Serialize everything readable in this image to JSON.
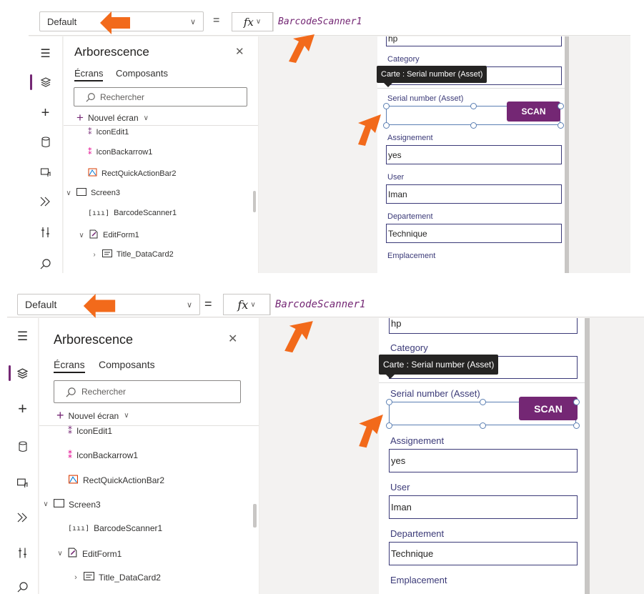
{
  "formula_bar": {
    "property": "Default",
    "equals": "=",
    "fx": "fx",
    "fx_chevron": "∨",
    "select_chevron": "∨",
    "formula": "BarcodeScanner1"
  },
  "tree_view": {
    "title": "Arborescence",
    "close": "✕",
    "tabs": [
      "Écrans",
      "Composants"
    ],
    "search_placeholder": "Rechercher",
    "new_screen": "Nouvel écran",
    "items": [
      {
        "label": "IconEdit1"
      },
      {
        "label": "IconBackarrow1"
      },
      {
        "label": "RectQuickActionBar2"
      },
      {
        "label": "Screen3"
      },
      {
        "label": "BarcodeScanner1"
      },
      {
        "label": "EditForm1"
      },
      {
        "label": "Title_DataCard2"
      }
    ]
  },
  "form": {
    "top_value": "hp",
    "tooltip": "Carte : Serial number (Asset)",
    "category_label": "Category",
    "serial_label": "Serial number (Asset)",
    "serial_value": "",
    "scan_label": "SCAN",
    "assignement_label": "Assignement",
    "assignement_value": "yes",
    "user_label": "User",
    "user_value": "Iman",
    "departement_label": "Departement",
    "departement_value": "Technique",
    "emplacement_label": "Emplacement"
  },
  "colors": {
    "accent": "#742774",
    "annotation_arrow": "#f26a1b",
    "form_text": "#3b3a78"
  }
}
